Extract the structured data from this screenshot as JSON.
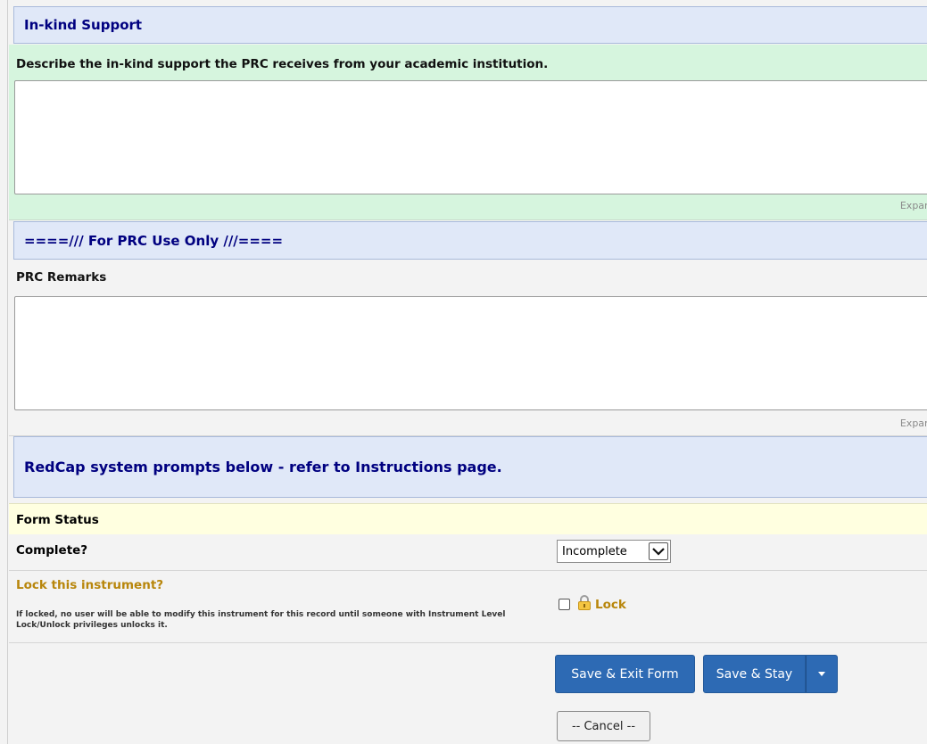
{
  "sections": {
    "in_kind": {
      "title": "In-kind Support"
    },
    "prc_use": {
      "title": "====/// For PRC Use Only ///===="
    },
    "system": {
      "title": "RedCap system prompts below - refer to Instructions page."
    }
  },
  "fields": {
    "in_kind_desc": {
      "label": "Describe the in-kind support the PRC receives from your academic institution.",
      "value": "",
      "expand": "Expand"
    },
    "prc_remarks": {
      "label": "PRC Remarks",
      "value": "",
      "expand": "Expand"
    }
  },
  "form_status": {
    "title": "Form Status",
    "complete_label": "Complete?",
    "complete_value": "Incomplete"
  },
  "lock": {
    "title": "Lock this instrument?",
    "description": "If locked, no user will be able to modify this instrument for this record until someone with Instrument Level Lock/Unlock privileges unlocks it.",
    "label": "Lock",
    "checked": false
  },
  "buttons": {
    "save_exit": "Save & Exit Form",
    "save_stay": "Save & Stay",
    "cancel": "-- Cancel --"
  },
  "colors": {
    "section_header_bg": "#e0e8f8",
    "section_header_text": "#000080",
    "field_green_bg": "#d6f5de",
    "status_bg": "#ffffe0",
    "primary_button": "#2d6ab4",
    "lock_text": "#b8860b"
  }
}
